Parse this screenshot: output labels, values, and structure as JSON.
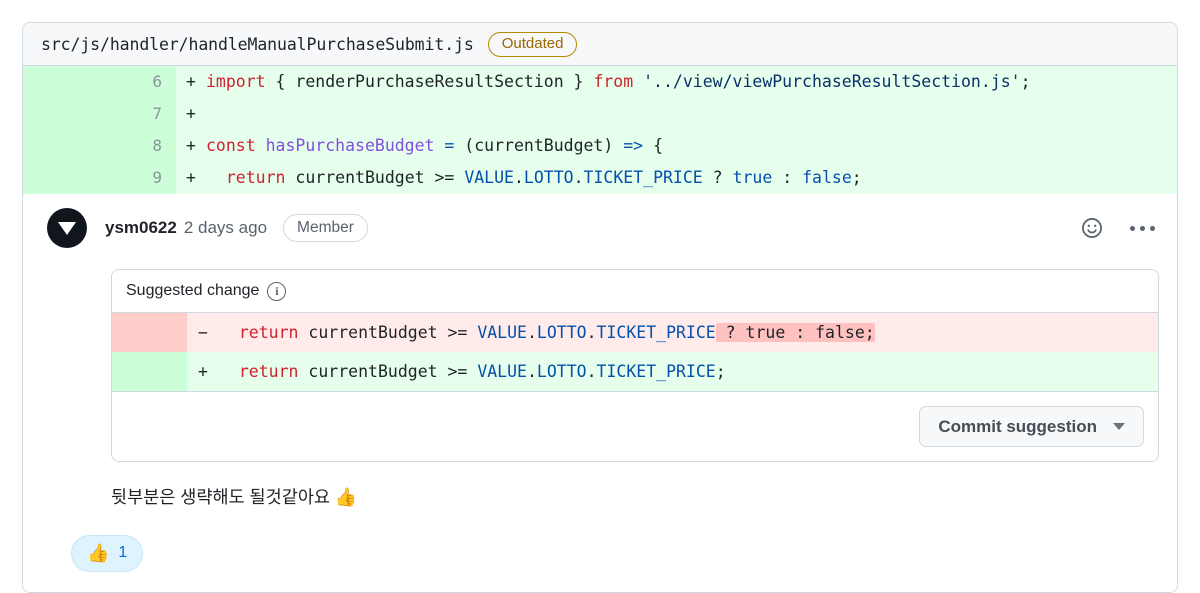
{
  "file": {
    "path": "src/js/handler/handleManualPurchaseSubmit.js",
    "badge": "Outdated"
  },
  "diff": {
    "lines": [
      {
        "number": "6",
        "marker": "+",
        "tokens": [
          {
            "t": "import ",
            "c": "kw"
          },
          {
            "t": "{ renderPurchaseResultSection } ",
            "c": "plain"
          },
          {
            "t": "from ",
            "c": "kw"
          },
          {
            "t": "'../view/viewPurchaseResultSection.js'",
            "c": "str"
          },
          {
            "t": ";",
            "c": "plain"
          }
        ]
      },
      {
        "number": "7",
        "marker": "+",
        "tokens": [
          {
            "t": "",
            "c": "plain"
          }
        ]
      },
      {
        "number": "8",
        "marker": "+",
        "tokens": [
          {
            "t": "const ",
            "c": "kw"
          },
          {
            "t": "hasPurchaseBudget ",
            "c": "fn"
          },
          {
            "t": "= ",
            "c": "op"
          },
          {
            "t": "(currentBudget) ",
            "c": "plain"
          },
          {
            "t": "=> ",
            "c": "op"
          },
          {
            "t": "{",
            "c": "plain"
          }
        ]
      },
      {
        "number": "9",
        "marker": "+",
        "tokens": [
          {
            "t": "  ",
            "c": "plain"
          },
          {
            "t": "return ",
            "c": "kw"
          },
          {
            "t": "currentBudget >= ",
            "c": "plain"
          },
          {
            "t": "VALUE",
            "c": "const"
          },
          {
            "t": ".",
            "c": "plain"
          },
          {
            "t": "LOTTO",
            "c": "const"
          },
          {
            "t": ".",
            "c": "plain"
          },
          {
            "t": "TICKET_PRICE",
            "c": "const"
          },
          {
            "t": " ? ",
            "c": "plain"
          },
          {
            "t": "true",
            "c": "const"
          },
          {
            "t": " : ",
            "c": "plain"
          },
          {
            "t": "false",
            "c": "const"
          },
          {
            "t": ";",
            "c": "plain"
          }
        ]
      }
    ]
  },
  "comment": {
    "author": "ysm0622",
    "timestamp": "2 days ago",
    "role_badge": "Member",
    "reaction_icon": "smiley-icon",
    "menu_icon": "kebab-menu-icon",
    "body_text": "뒷부분은 생략해도 될것같아요 ",
    "body_emoji": "👍"
  },
  "suggestion": {
    "title": "Suggested change",
    "info_icon": "i",
    "deleted": {
      "marker": "−",
      "tokens": [
        {
          "t": "  ",
          "c": "plain"
        },
        {
          "t": "return ",
          "c": "kw"
        },
        {
          "t": "currentBudget >= ",
          "c": "plain"
        },
        {
          "t": "VALUE",
          "c": "const"
        },
        {
          "t": ".",
          "c": "plain"
        },
        {
          "t": "LOTTO",
          "c": "const"
        },
        {
          "t": ".",
          "c": "plain"
        },
        {
          "t": "TICKET_PRICE",
          "c": "const"
        },
        {
          "t": " ? true : false;",
          "c": "plain",
          "hl": true
        }
      ]
    },
    "added": {
      "marker": "+",
      "tokens": [
        {
          "t": "  ",
          "c": "plain"
        },
        {
          "t": "return ",
          "c": "kw"
        },
        {
          "t": "currentBudget >= ",
          "c": "plain"
        },
        {
          "t": "VALUE",
          "c": "const"
        },
        {
          "t": ".",
          "c": "plain"
        },
        {
          "t": "LOTTO",
          "c": "const"
        },
        {
          "t": ".",
          "c": "plain"
        },
        {
          "t": "TICKET_PRICE",
          "c": "const"
        },
        {
          "t": ";",
          "c": "plain"
        }
      ]
    },
    "commit_button": "Commit suggestion"
  },
  "reactions": [
    {
      "emoji": "👍",
      "count": "1"
    }
  ],
  "colors": {
    "diff_add_bg": "#e6ffec",
    "diff_add_gutter": "#ccffd8",
    "diff_del_bg": "#ffebe9",
    "diff_del_gutter": "#ffcecb",
    "word_del_hl": "#ffc1c0",
    "badge_outdated": "#9a6700",
    "accent_blue": "#0969da"
  }
}
